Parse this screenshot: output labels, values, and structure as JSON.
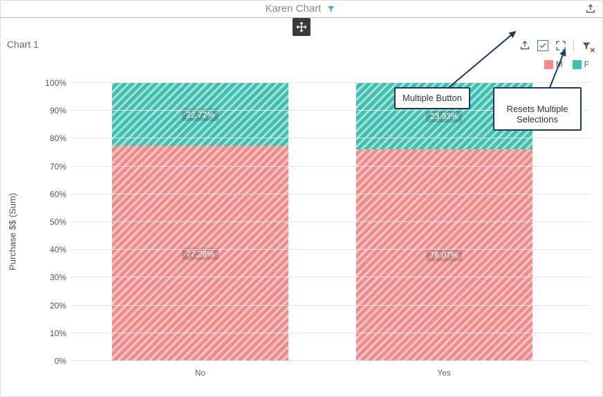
{
  "header": {
    "title": "Karen Chart"
  },
  "panel": {
    "title": "Chart 1"
  },
  "legend": {
    "m": "M",
    "f": "F"
  },
  "axis": {
    "y_label": "Purchase $$ (Sum)",
    "y_ticks": [
      "0%",
      "10%",
      "20%",
      "30%",
      "40%",
      "50%",
      "60%",
      "70%",
      "80%",
      "90%",
      "100%"
    ],
    "x_ticks": [
      "No",
      "Yes"
    ]
  },
  "chart_data": {
    "type": "bar",
    "stacked": true,
    "percent": true,
    "categories": [
      "No",
      "Yes"
    ],
    "series": [
      {
        "name": "M",
        "color": "#f28a8a",
        "values": [
          77.28,
          76.07
        ]
      },
      {
        "name": "F",
        "color": "#3fbfad",
        "values": [
          22.72,
          23.93
        ]
      }
    ],
    "labels": {
      "No": {
        "M": "77.28%",
        "F": "22.72%"
      },
      "Yes": {
        "M": "76.07%",
        "F": "23.93%"
      }
    },
    "ylabel": "Purchase $$ (Sum)",
    "ylim": [
      0,
      100
    ]
  },
  "callouts": {
    "multiple_button": "Multiple Button",
    "resets_multiple": "Resets Multiple\nSelections"
  },
  "colors": {
    "m": "#f28a8a",
    "f": "#3fbfad",
    "accent": "#3b78c4",
    "callout_border": "#1b3a66"
  }
}
